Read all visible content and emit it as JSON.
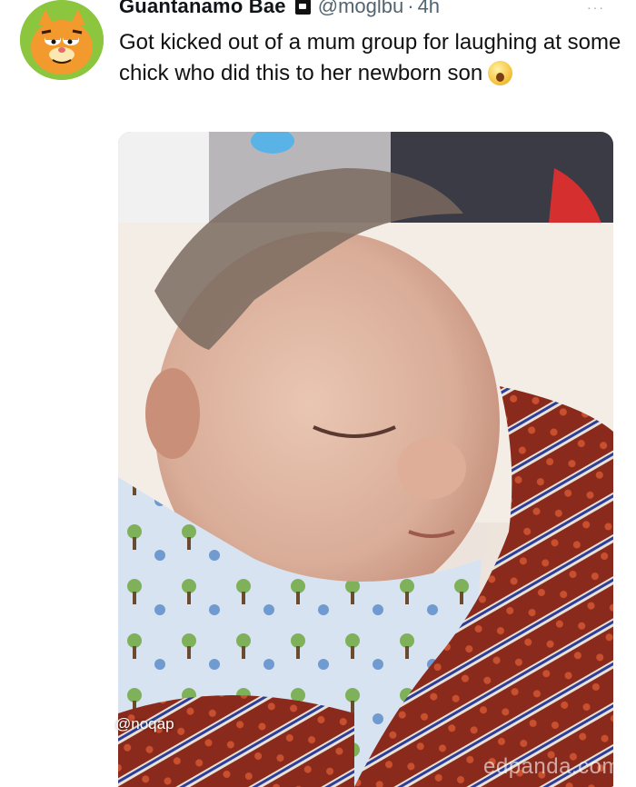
{
  "tweet": {
    "display_name": "Guantanamo Bae",
    "handle": "@moglbu",
    "separator": "·",
    "time": "4h",
    "text": "Got kicked out of a mum group for laughing at some chick who did this to her newborn son",
    "emoji": "crying-laughing-emoji"
  },
  "photo": {
    "subject": "",
    "watermark": "@noqap"
  },
  "site_watermark": "edpanda.com",
  "icons": {
    "avatar": "garfield-avatar",
    "badge": "verified-badge-icon",
    "menu": "more-dots-icon"
  },
  "colors": {
    "text": "#0f1419",
    "handle": "#536471"
  }
}
